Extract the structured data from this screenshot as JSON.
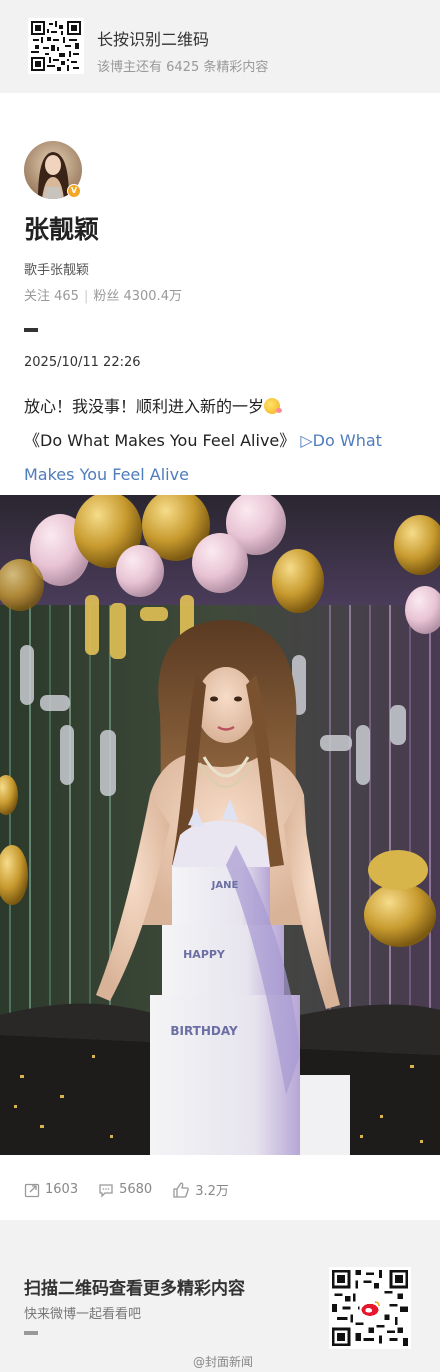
{
  "header": {
    "title": "长按识别二维码",
    "subtitle": "该博主还有 6425 条精彩内容",
    "qr_icon": "qr-code-icon"
  },
  "profile": {
    "name": "张靓颖",
    "bio": "歌手张靓颖",
    "following_label": "关注 465",
    "followers_label": "粉丝 4300.4万",
    "verified_badge": "V",
    "badge_color": "#f5a623"
  },
  "post": {
    "date": "2025/10/11 22:26",
    "line1": "放心！我没事！顺利进入新的一岁",
    "song_title": "《Do What Makes You Feel Alive》",
    "song_link_icon": "▷",
    "song_link_text": "Do What Makes You Feel Alive",
    "link_color": "#4e7cbc"
  },
  "stats": {
    "reposts": "1603",
    "comments": "5680",
    "likes": "3.2万"
  },
  "footer": {
    "title": "扫描二维码查看更多精彩内容",
    "subtitle": "快来微博一起看看吧",
    "watermark": "@封面新闻"
  }
}
